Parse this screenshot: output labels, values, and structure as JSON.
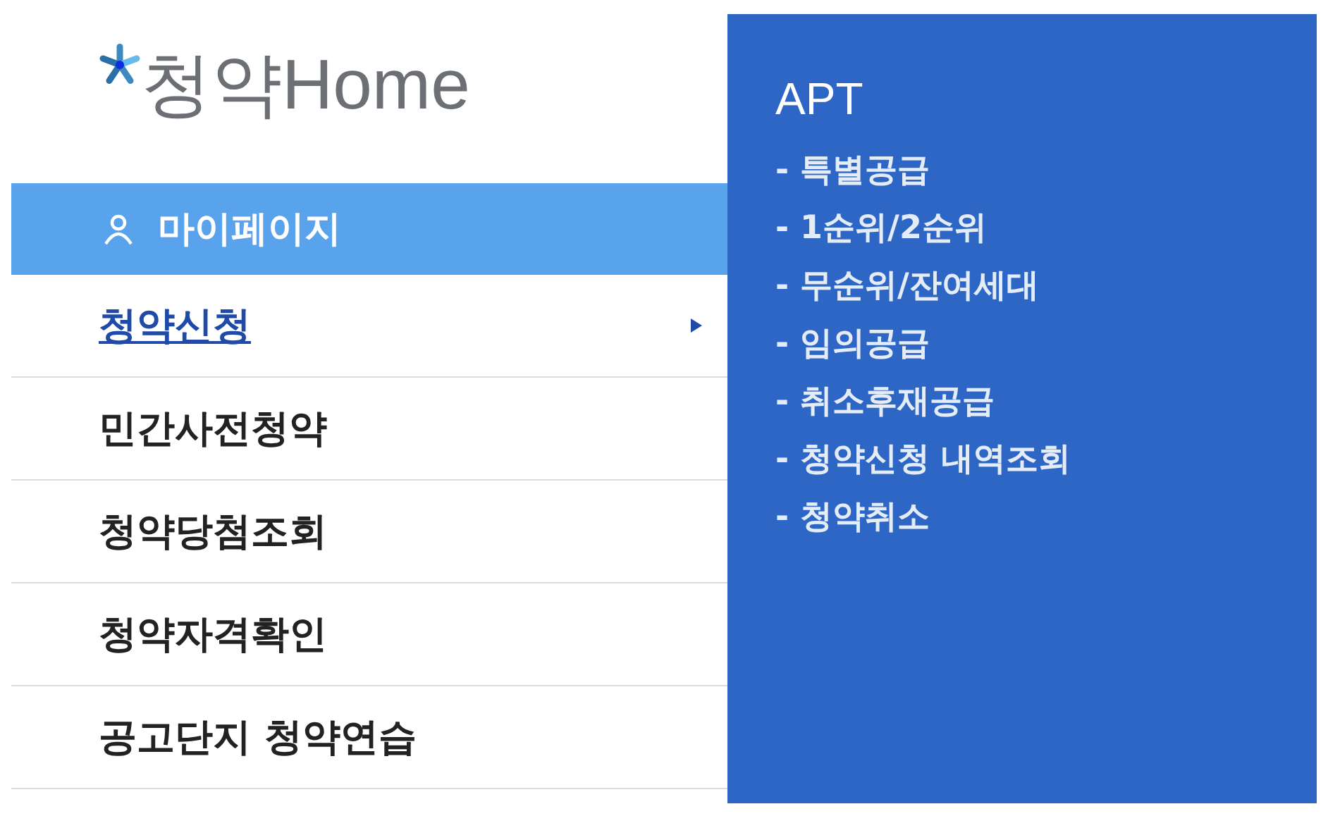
{
  "logo": {
    "text": "청약Home"
  },
  "mypage": {
    "label": "마이페이지"
  },
  "menu": [
    {
      "label": "청약신청",
      "selected": true
    },
    {
      "label": "민간사전청약",
      "selected": false
    },
    {
      "label": "청약당첨조회",
      "selected": false
    },
    {
      "label": "청약자격확인",
      "selected": false
    },
    {
      "label": "공고단지 청약연습",
      "selected": false
    }
  ],
  "submenu": {
    "heading": "APT",
    "items": [
      "- 특별공급",
      "- 1순위/2순위",
      "- 무순위/잔여세대",
      "- 임의공급",
      "- 취소후재공급",
      "- 청약신청 내역조회",
      "- 청약취소"
    ]
  }
}
